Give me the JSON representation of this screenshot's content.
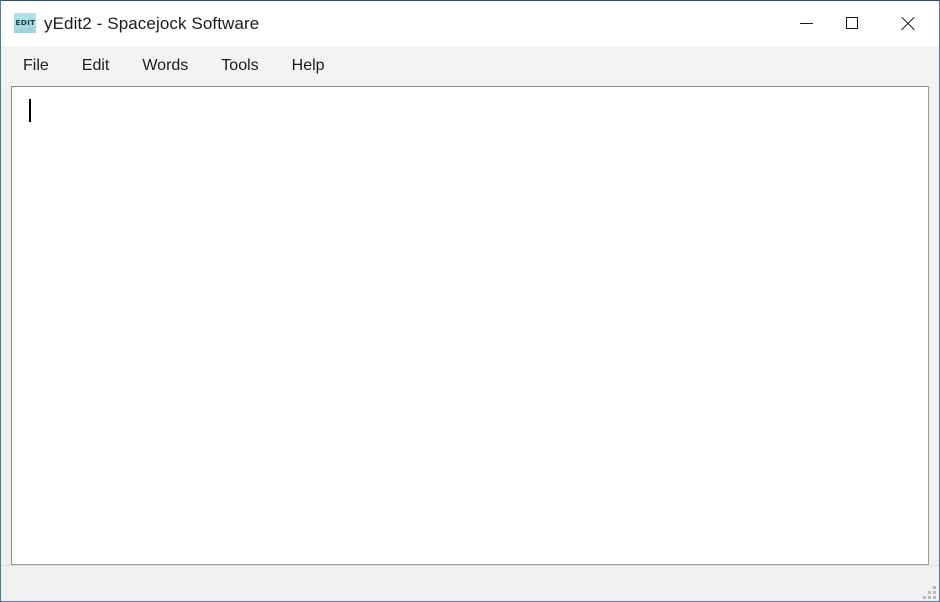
{
  "window": {
    "title": "yEdit2 - Spacejock Software",
    "icon_label": "EDIT",
    "icon_name": "yedit-app-icon",
    "border_color": "#4a7d94",
    "titlebar_bg": "#ffffff",
    "menubar_bg": "#f3f3f3",
    "client_bg": "#f0f0f0"
  },
  "window_controls": {
    "minimize": {
      "name": "minimize-icon",
      "tooltip": "Minimize"
    },
    "maximize": {
      "name": "maximize-icon",
      "tooltip": "Maximize"
    },
    "close": {
      "name": "close-icon",
      "tooltip": "Close"
    }
  },
  "menubar": {
    "items": [
      {
        "label": "File"
      },
      {
        "label": "Edit"
      },
      {
        "label": "Words"
      },
      {
        "label": "Tools"
      },
      {
        "label": "Help"
      }
    ]
  },
  "editor": {
    "content": "",
    "caret_visible": true,
    "background": "#ffffff",
    "border_color": "#9a9a9a"
  },
  "statusbar": {
    "text": "",
    "grip_name": "resize-grip"
  }
}
